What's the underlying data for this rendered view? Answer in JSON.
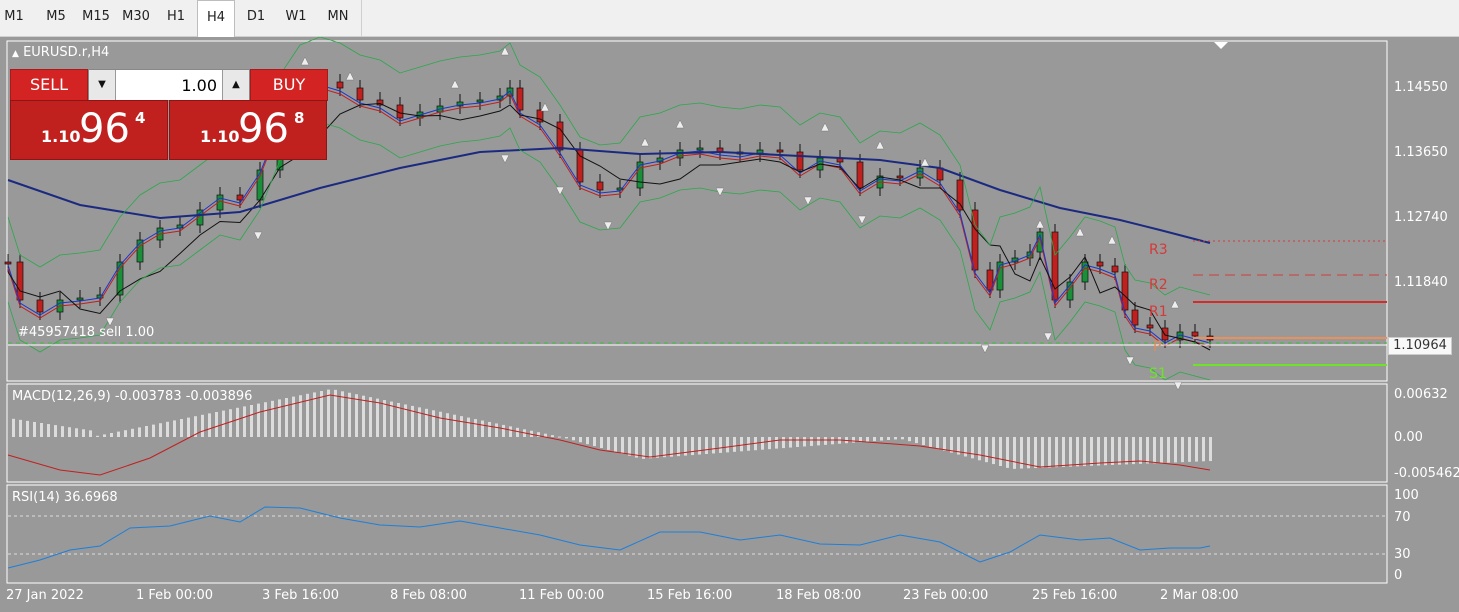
{
  "timeframes": [
    "M1",
    "M5",
    "M15",
    "M30",
    "H1",
    "H4",
    "D1",
    "W1",
    "MN"
  ],
  "active_timeframe": "H4",
  "chart": {
    "symbol_label": "EURUSD.r,H4",
    "order_label": "#45957418 sell 1.00",
    "current_price_tag": "1.10964",
    "price_axis": [
      "1.14550",
      "1.13650",
      "1.12740",
      "1.11840"
    ],
    "time_axis": [
      "27 Jan 2022",
      "1 Feb 00:00",
      "3 Feb 16:00",
      "8 Feb 08:00",
      "11 Feb 00:00",
      "15 Feb 16:00",
      "18 Feb 08:00",
      "23 Feb 00:00",
      "25 Feb 16:00",
      "2 Mar 08:00"
    ],
    "pivots": [
      "R3",
      "R2",
      "R1",
      "P",
      "S1"
    ]
  },
  "trade_panel": {
    "sell_label": "SELL",
    "buy_label": "BUY",
    "volume": "1.00",
    "down_icon": "▼",
    "up_icon": "▲",
    "sell_price": {
      "small": "1.10",
      "big": "96",
      "sup": "4"
    },
    "buy_price": {
      "small": "1.10",
      "big": "96",
      "sup": "8"
    }
  },
  "macd": {
    "label": "MACD(12,26,9) -0.003783 -0.003896",
    "axis": [
      "0.00632",
      "0.00",
      "-0.005462"
    ]
  },
  "rsi": {
    "label": "RSI(14) 36.6968",
    "axis": [
      "100",
      "70",
      "30",
      "0"
    ]
  },
  "colors": {
    "chart_bg": "#999999",
    "bull": "#1a8f3a",
    "bear": "#c0201e",
    "ma_slow": "#1b2a80",
    "ma_mid": "#111111",
    "rsi_line": "#1e7fd8",
    "macd_signal": "#c0201e"
  }
}
